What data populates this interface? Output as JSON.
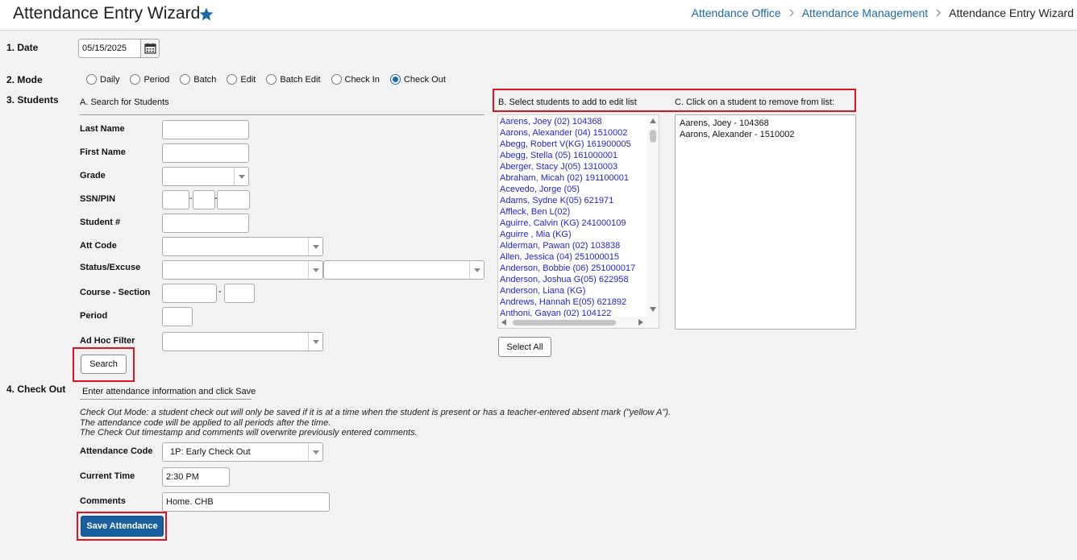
{
  "header": {
    "title": "Attendance Entry Wizard",
    "breadcrumb": [
      "Attendance Office",
      "Attendance Management",
      "Attendance Entry Wizard"
    ]
  },
  "date": {
    "label": "1. Date",
    "value": "05/15/2025"
  },
  "mode": {
    "label": "2. Mode",
    "options": [
      "Daily",
      "Period",
      "Batch",
      "Edit",
      "Batch Edit",
      "Check In",
      "Check Out"
    ],
    "selected": "Check Out"
  },
  "students": {
    "label": "3. Students",
    "search_header": "A. Search for Students",
    "fields": {
      "last_name": "Last Name",
      "first_name": "First Name",
      "grade": "Grade",
      "ssn": "SSN/PIN",
      "student_num": "Student #",
      "att_code": "Att Code",
      "status_excuse": "Status/Excuse",
      "course_section": "Course - Section",
      "period": "Period",
      "ad_hoc": "Ad Hoc Filter"
    },
    "search_button": "Search",
    "select_header": "B. Select students to add to edit list",
    "remove_header": "C. Click on a student to remove from list:",
    "available": [
      "Aarens, Joey (02) 104368",
      "Aarons, Alexander (04) 1510002",
      "Abegg, Robert V(KG) 161900005",
      "Abegg, Stella (05) 161000001",
      "Aberger, Stacy J(05) 1310003",
      "Abraham, Micah (02) 191100001",
      "Acevedo, Jorge (05)",
      "Adams, Sydne K(05) 621971",
      "Affleck, Ben L(02)",
      "Aguirre, Calvin (KG) 241000109",
      "Aguirre , Mia (KG)",
      "Alderman, Pawan (02) 103838",
      "Allen, Jessica (04) 251000015",
      "Anderson, Bobbie (06) 251000017",
      "Anderson, Joshua G(05) 622958",
      "Anderson, Liana (KG)",
      "Andrews, Hannah E(05) 621892",
      "Anthoni, Gayan (02) 104122"
    ],
    "selected": [
      "Aarens, Joey - 104368",
      "Aarons, Alexander - 1510002"
    ],
    "select_all": "Select All"
  },
  "checkout": {
    "label": "4. Check Out",
    "header": "Enter attendance information and click Save",
    "info": [
      "Check Out Mode: a student check out will only be saved if it is at a time when the student is present or has a teacher-entered absent mark (\"yellow A\").",
      "The attendance code will be applied to all periods after the time.",
      "The Check Out timestamp and comments will overwrite previously entered comments."
    ],
    "attendance_code_label": "Attendance Code",
    "attendance_code_value": "1P: Early Check Out",
    "current_time_label": "Current Time",
    "current_time_value": "2:30 PM",
    "comments_label": "Comments",
    "comments_value": "Home. CHB",
    "save_button": "Save Attendance"
  },
  "colors": {
    "accent": "#1a6aa8",
    "primary_button": "#1a5f9e",
    "highlight": "#e0141e",
    "link": "#2626c8"
  },
  "icons": {
    "favorite": "star-icon",
    "calendar": "calendar-icon",
    "dropdown": "chevron-down-icon",
    "separator": "chevron-right-icon"
  }
}
